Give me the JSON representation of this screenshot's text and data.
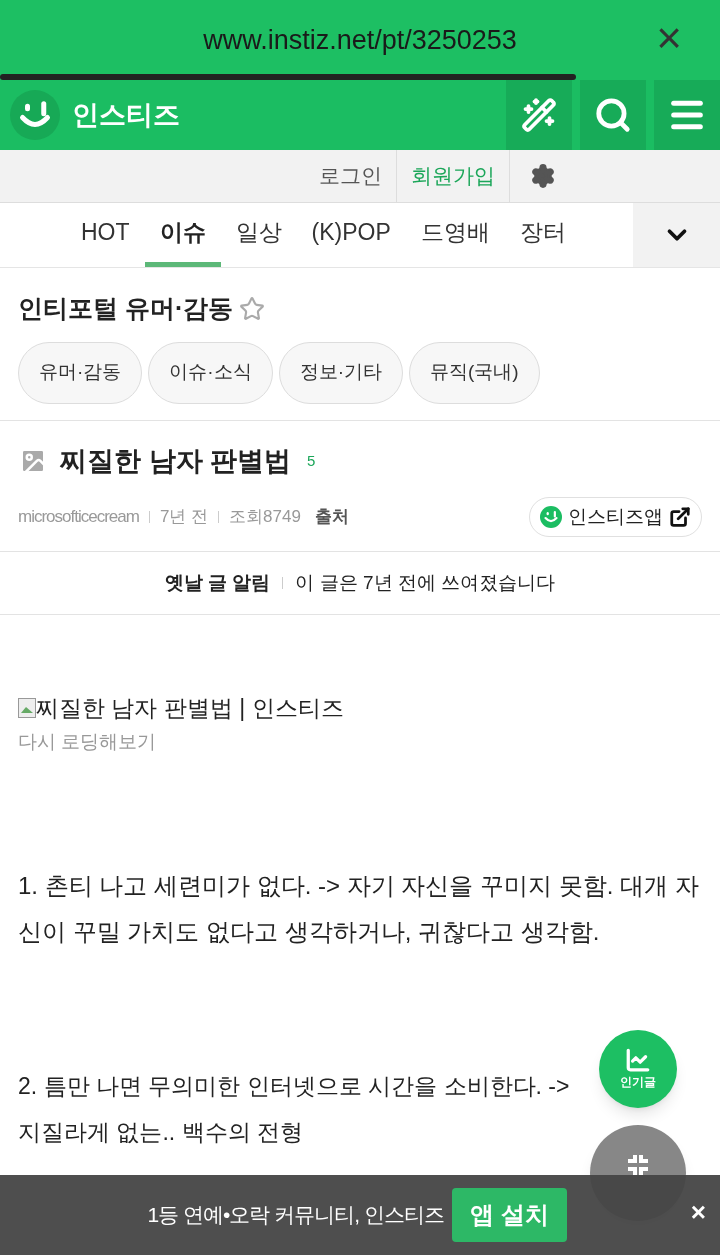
{
  "browser": {
    "url": "www.instiz.net/pt/3250253",
    "close": "×"
  },
  "header": {
    "logo": "인스티즈"
  },
  "account": {
    "login": "로그인",
    "signup": "회원가입"
  },
  "tabs": [
    {
      "label": "HOT",
      "selected": false
    },
    {
      "label": "이슈",
      "selected": true
    },
    {
      "label": "일상",
      "selected": false
    },
    {
      "label": "(K)POP",
      "selected": false
    },
    {
      "label": "드영배",
      "selected": false
    },
    {
      "label": "장터",
      "selected": false
    }
  ],
  "board": {
    "title": "인티포털 유머·감동",
    "starred": false,
    "chips": [
      "유머·감동",
      "이슈·소식",
      "정보·기타",
      "뮤직(국내)"
    ]
  },
  "post": {
    "title": "찌질한 남자 판별법",
    "comments": "5",
    "author": "microsofticecream",
    "time": "7년 전",
    "views": "조회8749",
    "source": "출처",
    "app_button": "인스티즈앱"
  },
  "notice": {
    "label": "옛날 글 알림",
    "text": "이 글은 7년 전에 쓰여졌습니다"
  },
  "content": {
    "image_alt": "찌질한 남자 판별법 | 인스티즈",
    "reload": "다시 로딩해보기",
    "paragraphs": [
      "1. 촌티 나고 세련미가 없다. -> 자기 자신을 꾸미지 못함. 대개 자신이 꾸밀 가치도 없다고 생각하거나, 귀찮다고 생각함.",
      "2. 틈만 나면 무의미한 인터넷으로 시간을 소비한다. ->",
      "지질라게 없는.. 백수의 전형"
    ]
  },
  "fab": {
    "popular": "인기글"
  },
  "banner": {
    "text": "1등 연예•오락 커뮤니티, 인스티즈",
    "install": "앱 설치",
    "close": "×"
  }
}
